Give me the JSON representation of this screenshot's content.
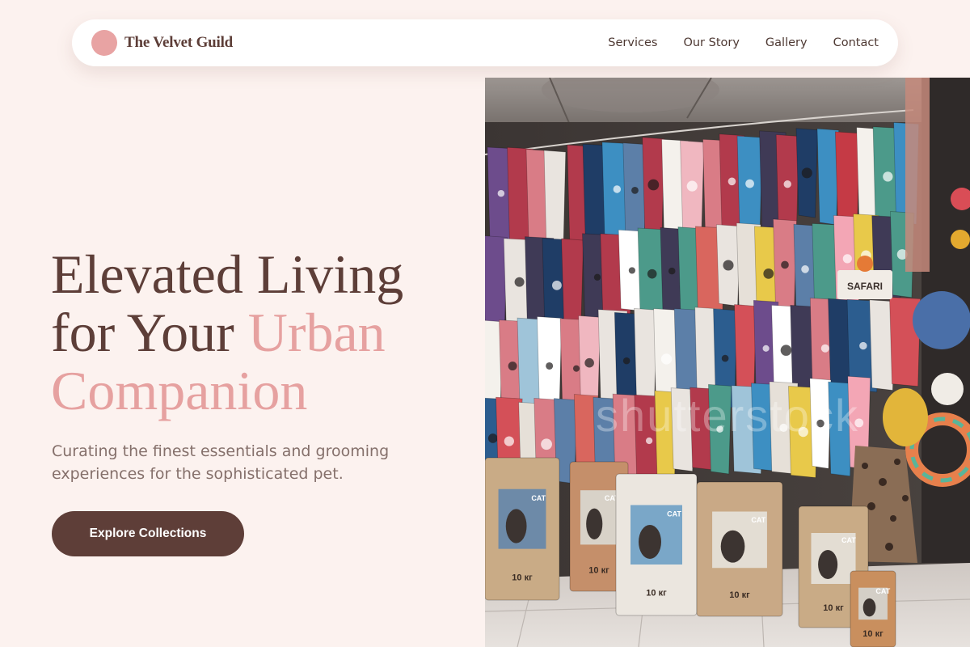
{
  "brand": {
    "name": "The Velvet Guild"
  },
  "nav": {
    "links": [
      "Services",
      "Our Story",
      "Gallery",
      "Contact"
    ]
  },
  "hero": {
    "title_line1": "Elevated Living",
    "title_line2_plain": "for Your ",
    "title_line2_accent": "Urban",
    "title_line3_accent": "Companion",
    "subtitle": "Curating the finest essentials and grooming experiences for the sophisticated pet.",
    "cta_label": "Explore Collections"
  },
  "image": {
    "watermark": "shutterstock",
    "sign_text": "SAFARI",
    "bag_label": "CAT",
    "bag_weight": "10 кг"
  },
  "colors": {
    "background": "#fcf2ef",
    "brand_dot": "#e8a3a3",
    "primary_text": "#5d3e38",
    "accent": "#e6a1a0",
    "muted_text": "#85706b",
    "button": "#5e3e38",
    "button_text": "#ffffff"
  }
}
